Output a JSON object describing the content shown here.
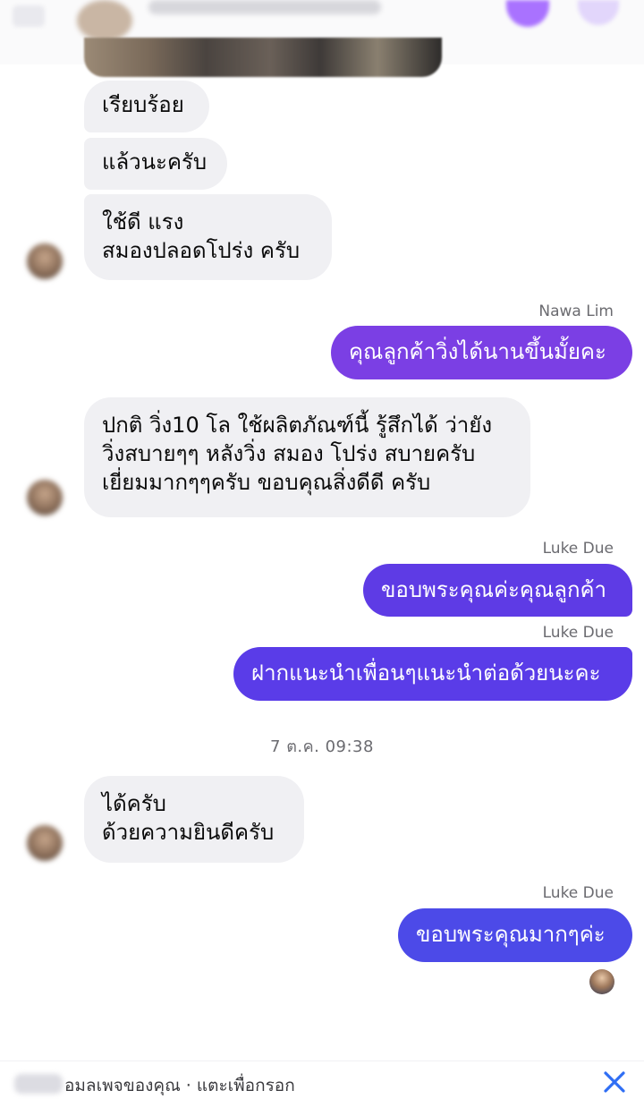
{
  "messages": [
    {
      "text": "เรียบร้อย"
    },
    {
      "text": "แล้วนะครับ"
    },
    {
      "text": "ใช้ดี แรง\nสมองปลอดโปร่ง ครับ"
    },
    {
      "sender": "Nawa Lim",
      "text": "คุณลูกค้าวิ่งได้นานขึ้นมั้ยคะ",
      "color": "#7b3fe4"
    },
    {
      "text": "ปกติ วิ่ง10 โล ใช้ผลิตภัณฑ์นี้ รู้สึกได้ ว่ายัง\nวิ่งสบายๆๆ หลังวิ่ง สมอง โปร่ง สบายครับ\nเยี่ยมมากๆๆครับ  ขอบคุณสิ่งดีดี ครับ"
    },
    {
      "sender": "Luke Due",
      "text": "ขอบพระคุณค่ะคุณลูกค้า",
      "color": "#5e3be5"
    },
    {
      "sender": "Luke Due",
      "text": "ฝากแนะนำเพื่อนๆแนะนำต่อด้วยนะคะ",
      "color": "#5a3ce8"
    },
    {
      "timestamp": "7 ต.ค. 09:38"
    },
    {
      "text": "ได้ครับ\nด้วยความยินดีครับ"
    },
    {
      "sender": "Luke Due",
      "text": "ขอบพระคุณมากๆค่ะ",
      "color": "#4c4ae8"
    }
  ],
  "composer": {
    "hint": "อมลเพจของคุณ · แตะเพื่อกรอก"
  },
  "icons": {
    "close": "close-icon"
  }
}
